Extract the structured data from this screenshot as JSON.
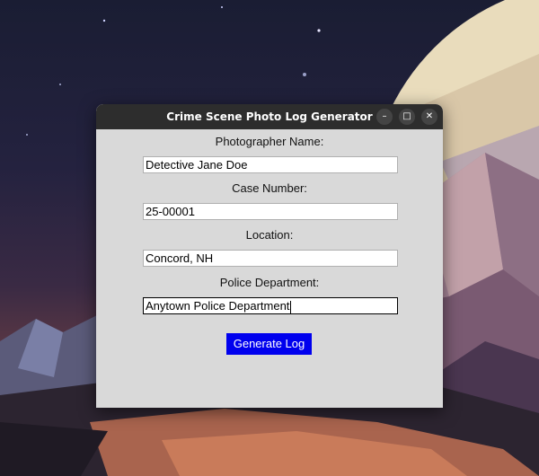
{
  "window": {
    "title": "Crime Scene Photo Log Generator"
  },
  "form": {
    "photographer_label": "Photographer Name:",
    "photographer_value": "Detective Jane Doe",
    "case_label": "Case Number:",
    "case_value": "25-00001",
    "location_label": "Location:",
    "location_value": "Concord, NH",
    "department_label": "Police Department:",
    "department_value": "Anytown Police Department",
    "generate_label": "Generate Log"
  },
  "icons": {
    "minimize": "minimize-icon",
    "maximize": "maximize-icon",
    "close": "close-icon"
  },
  "colors": {
    "generate_button": "#0000ee",
    "titlebar": "#2d2d2d",
    "window_bg": "#d9d9d9"
  }
}
